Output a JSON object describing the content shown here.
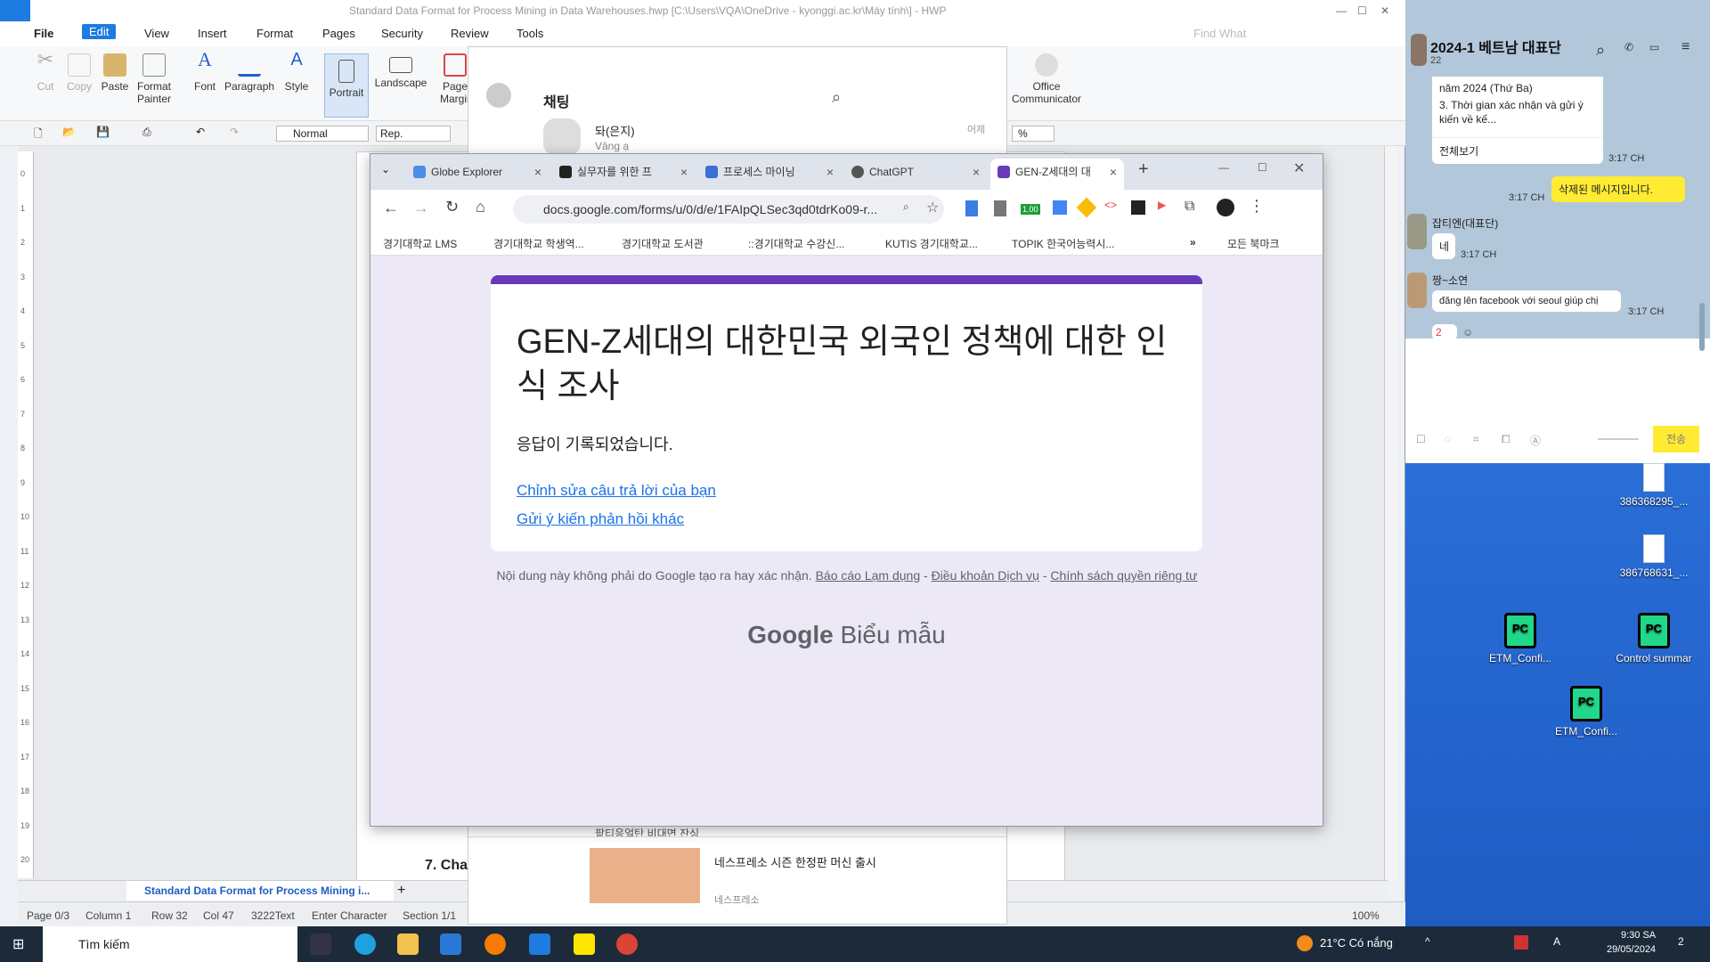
{
  "hwp": {
    "title": "Standard Data Format for Process Mining in Data Warehouses.hwp [C:\\Users\\VQA\\OneDrive - kyonggi.ac.kr\\Máy tính\\] - HWP",
    "menu": [
      "File",
      "Edit",
      "View",
      "Insert",
      "Format",
      "Pages",
      "Security",
      "Review",
      "Tools"
    ],
    "find_placeholder": "Find What",
    "ribbon": [
      "Cut",
      "Copy",
      "Paste",
      "Format Painter",
      "Font",
      "Paragraph",
      "Style",
      "Portrait",
      "Landscape",
      "Page Margins",
      "Office Communicator"
    ],
    "style_value": "Normal",
    "font_value": "Rep.",
    "zoom_symbol": "%",
    "doc_tab": "Standard Data Format for Process Mining i...",
    "doc_heading_partial": "7.   Cha",
    "status": {
      "page": "Page 0/3",
      "column": "Column 1",
      "row": "Row 32",
      "col": "Col 47",
      "text": "3222Text",
      "mode": "Enter Character",
      "section": "Section 1/1",
      "zoom": "100%"
    },
    "ruler_numbers": [
      "0",
      "1",
      "2",
      "3",
      "4",
      "5",
      "6",
      "7",
      "8",
      "9",
      "10",
      "11",
      "12",
      "13",
      "14",
      "15",
      "16",
      "17",
      "18",
      "19",
      "20"
    ]
  },
  "chat_behind": {
    "header": "채팅",
    "name": "돠(은지)",
    "preview": "Vâng ạ",
    "time": "어제",
    "bottom_preview": "팥티응얼탄 비대면 잔싱",
    "ad_title": "네스프레소 시즌 한정판 머신 출시",
    "ad_brand": "네스프레소"
  },
  "chrome": {
    "tabs": [
      "Globe Explorer",
      "실무자를 위한 프",
      "프로세스 마이닝",
      "ChatGPT",
      "GEN-Z세대의 대"
    ],
    "url": "docs.google.com/forms/u/0/d/e/1FAIpQLSec3qd0tdrKo09-r...",
    "ext_badge": "1.00",
    "bookmarks": [
      "경기대학교 LMS",
      "경기대학교 학생역...",
      "경기대학교 도서관",
      "::경기대학교 수강신...",
      "KUTIS 경기대학교...",
      "TOPIK 한국어능력시..."
    ],
    "bookmarks_all": "모든 북마크",
    "form_title": "GEN-Z세대의 대한민국 외국인 정책에 대한 인식 조사",
    "form_message": "응답이 기록되었습니다.",
    "link_edit": "Chỉnh sửa câu trả lời của bạn",
    "link_another": "Gửi ý kiến phản hồi khác",
    "footer_prefix": "Nội dung này không phải do Google tạo ra hay xác nhận. ",
    "footer_report": "Báo cáo Lạm dụng",
    "footer_terms": "Điều khoản Dịch vụ",
    "footer_privacy": "Chính sách quyền riêng tư",
    "brand_google": "Google",
    "brand_forms": "Biểu mẫu"
  },
  "kakao": {
    "room": "2024-1 베트남 대표단",
    "members": "22",
    "msg1_line1": "năm 2024 (Thứ Ba)",
    "msg1_line2": "3. Thời gian xác nhận và gửi ý kiến về kế...",
    "view_all": "전체보기",
    "time1": "3:17 CH",
    "time2": "3:17 CH",
    "deleted": "삭제된 메시지입니다.",
    "sender2": "잡티엔(대표단)",
    "msg2": "네",
    "time3": "3:17 CH",
    "sender3": "짱~소연",
    "msg3": "đăng lên facebook với seoul giúp chị",
    "time4": "3:17 CH",
    "reaction_count": "2",
    "send": "전송"
  },
  "desktop": {
    "icons": [
      "386368295_...",
      "386768631_...",
      "ETM_Confi...",
      "Control summar",
      "ETM_Confi..."
    ]
  },
  "taskbar": {
    "search": "Tìm kiếm",
    "weather": "21°C  Có nắng",
    "time": "9:30 SA",
    "date": "29/05/2024",
    "notif": "2"
  }
}
